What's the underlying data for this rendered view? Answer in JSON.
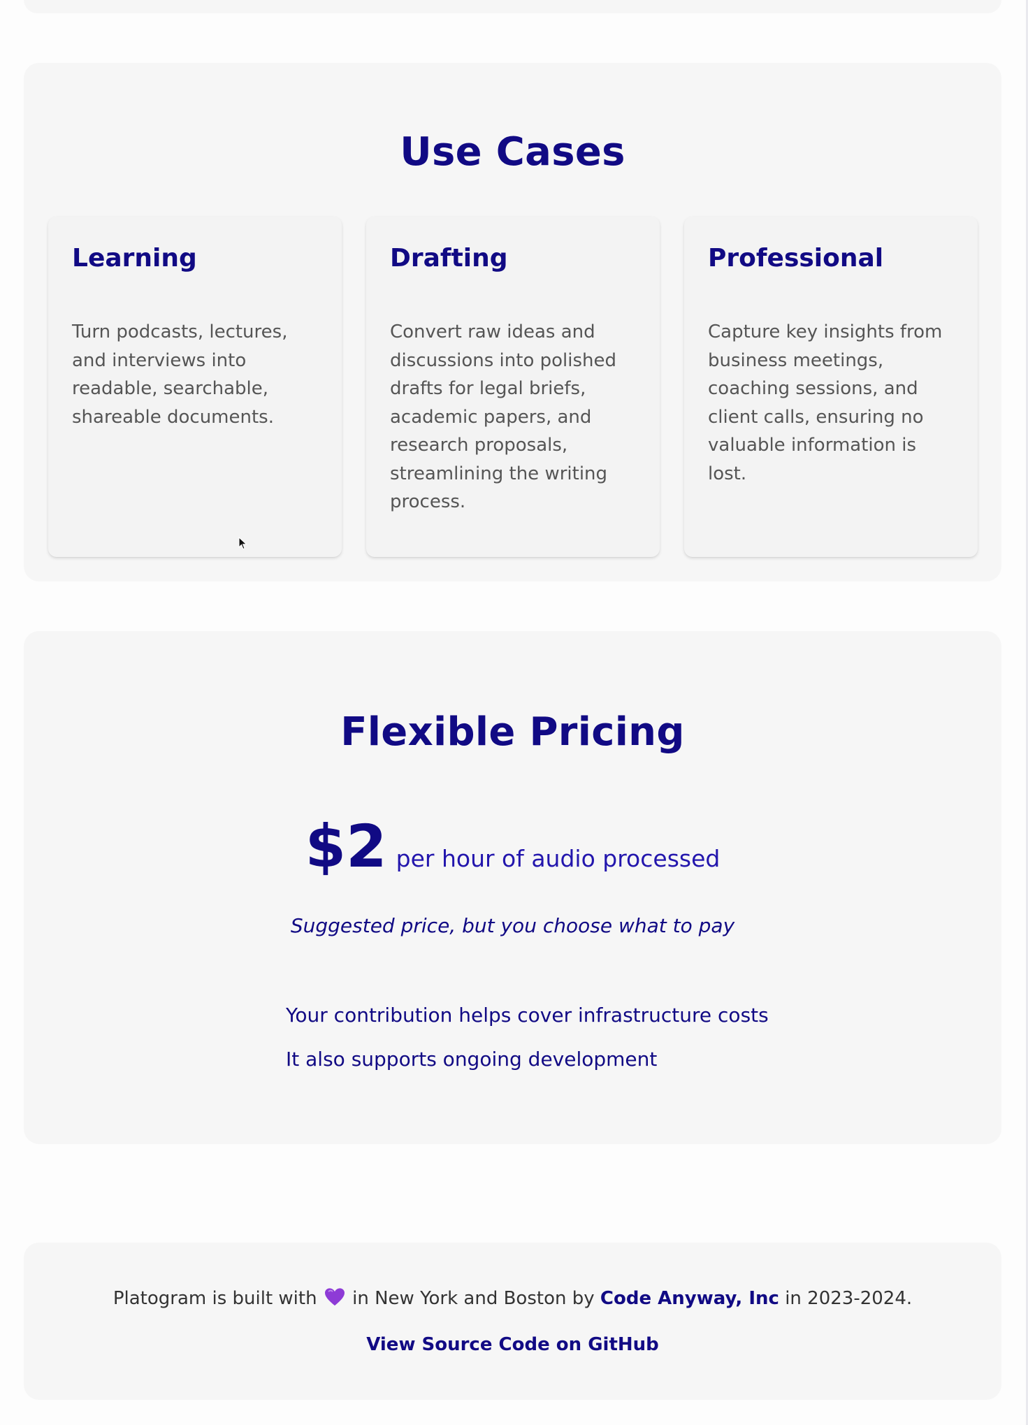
{
  "use_cases": {
    "title": "Use Cases",
    "cards": [
      {
        "title": "Learning",
        "description": "Turn podcasts, lectures, and interviews into readable, searchable, shareable documents."
      },
      {
        "title": "Drafting",
        "description": "Convert raw ideas and discussions into polished drafts for legal briefs, academic papers, and research proposals, streamlining the writing process."
      },
      {
        "title": "Professional",
        "description": "Capture key insights from business meetings, coaching sessions, and client calls, ensuring no valuable information is lost."
      }
    ]
  },
  "pricing": {
    "title": "Flexible Pricing",
    "amount": "$2",
    "unit": "per hour of audio processed",
    "note": "Suggested price, but you choose what to pay",
    "benefits": [
      "Your contribution helps cover infrastructure costs",
      "It also supports ongoing development"
    ]
  },
  "footer": {
    "prefix": "Platogram is built with",
    "middle": "in New York and Boston by",
    "company_link": "Code Anyway, Inc",
    "suffix": "in 2023-2024.",
    "github_link": "View Source Code on GitHub",
    "heart_icon": "purple-heart-icon"
  },
  "colors": {
    "heading": "#110a84",
    "body_text": "#555555",
    "panel_bg": "#f6f6f6",
    "card_bg": "#f3f3f3",
    "heart": "#8e3bd6"
  }
}
